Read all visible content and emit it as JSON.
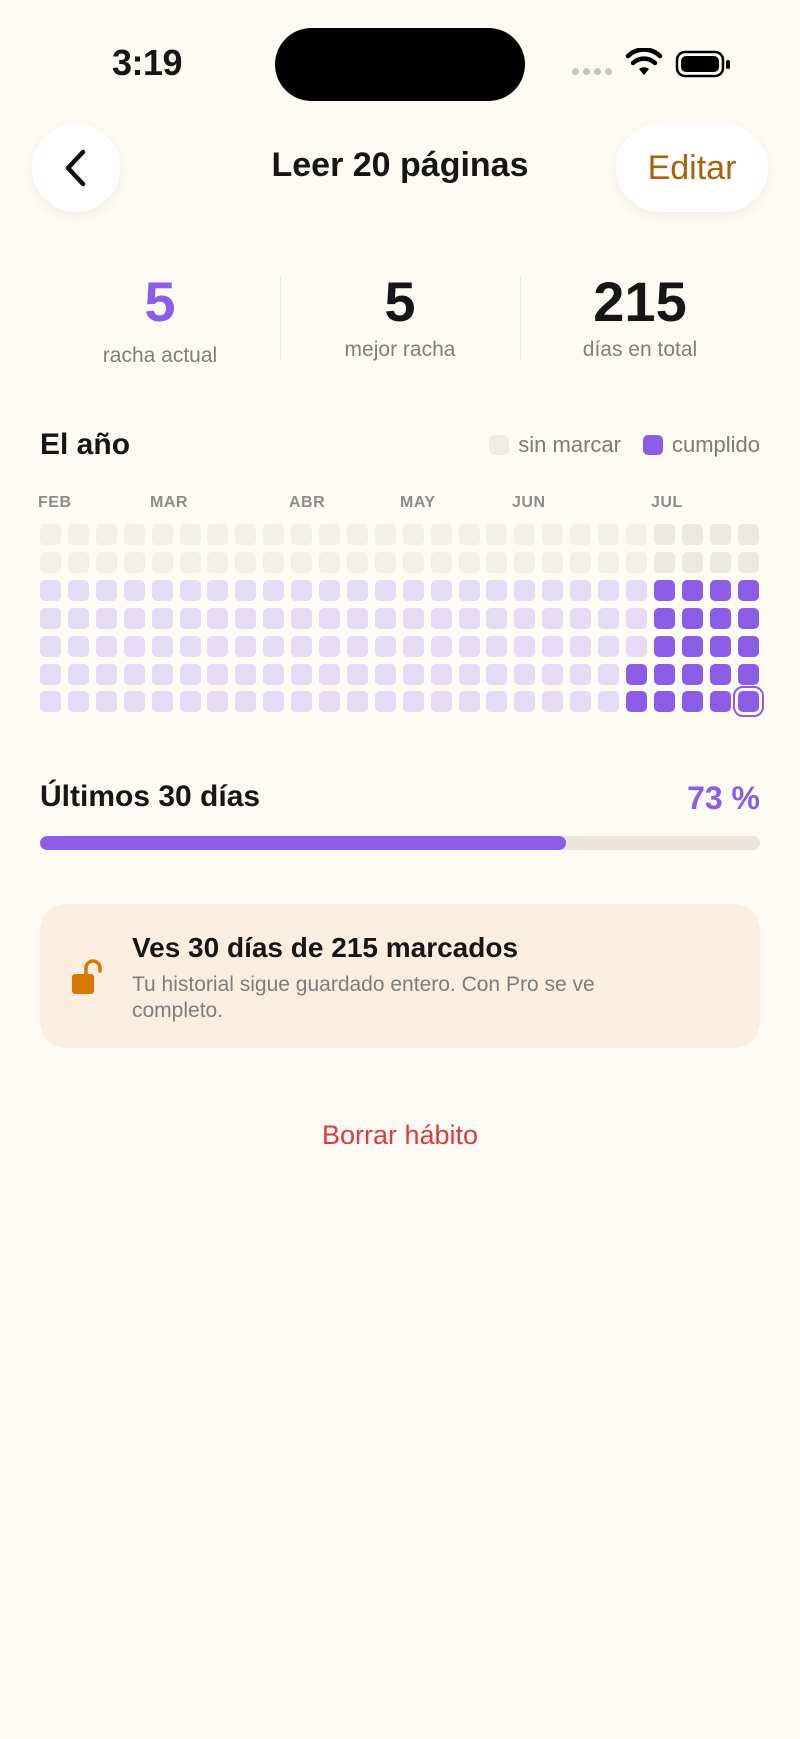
{
  "status_bar": {
    "time": "3:19"
  },
  "header": {
    "back_icon": "chevron-left-icon",
    "title": "Leer 20 páginas",
    "edit_label": "Editar"
  },
  "stats": [
    {
      "value": "5",
      "label": "racha actual",
      "color": "#8b5ce6"
    },
    {
      "value": "5",
      "label": "mejor racha",
      "color": "#161616"
    },
    {
      "value": "215",
      "label": "días en total",
      "color": "#161616"
    }
  ],
  "year": {
    "title": "El año",
    "legend": [
      {
        "label": "sin marcar",
        "color": "#efece6"
      },
      {
        "label": "cumplido",
        "color": "#8b5ce6"
      }
    ],
    "months": [
      "FEB",
      "MAR",
      "ABR",
      "MAY",
      "JUN",
      "JUL"
    ],
    "colors": {
      "unmarked": "#f3f0ea",
      "unmarked_recent": "#ece9e3",
      "faded": "#e6dbf4",
      "done": "#8b5ce6",
      "today_outline": "#8b5ce6"
    },
    "weeks": 26,
    "days_per_week": 7,
    "marked_history_note": "faded cells represent history hidden behind Pro",
    "recent_weeks": [
      {
        "week": 21,
        "rows": [
          "none",
          "none",
          "faded",
          "faded",
          "faded",
          "done",
          "done"
        ]
      },
      {
        "week": 22,
        "rows": [
          "recent",
          "recent",
          "done",
          "done",
          "done",
          "done",
          "done"
        ]
      },
      {
        "week": 23,
        "rows": [
          "recent",
          "recent",
          "done",
          "done",
          "done",
          "done",
          "done"
        ]
      },
      {
        "week": 24,
        "rows": [
          "recent",
          "recent",
          "done",
          "done",
          "done",
          "done",
          "done"
        ]
      },
      {
        "week": 25,
        "rows": [
          "recent",
          "recent",
          "done",
          "done",
          "done",
          "done",
          "today"
        ]
      }
    ]
  },
  "progress": {
    "title": "Últimos 30 días",
    "percent_label": "73 %",
    "fraction": 0.73
  },
  "pro_card": {
    "icon": "unlocked-padlock-icon",
    "title": "Ves 30 días de 215 marcados",
    "subtitle": "Tu historial sigue guardado entero. Con Pro se ve completo."
  },
  "delete_label": "Borrar hábito"
}
